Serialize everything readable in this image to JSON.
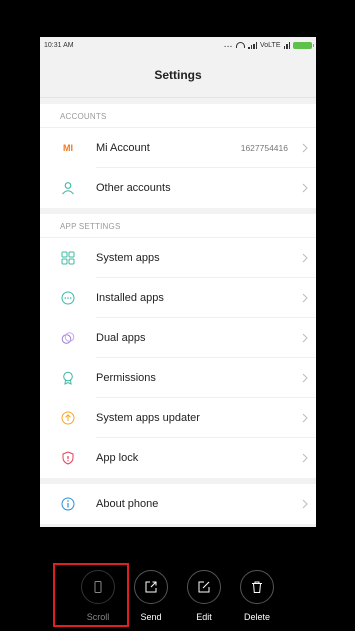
{
  "status": {
    "time": "10:31 AM",
    "dots": "...",
    "network": "VoLTE"
  },
  "header": {
    "title": "Settings"
  },
  "sections": [
    {
      "title": "ACCOUNTS",
      "items": [
        {
          "label": "Mi Account",
          "value": "1627754416",
          "icon": "mi-logo-icon"
        },
        {
          "label": "Other accounts",
          "icon": "person-icon"
        }
      ]
    },
    {
      "title": "APP SETTINGS",
      "items": [
        {
          "label": "System apps",
          "icon": "grid-icon"
        },
        {
          "label": "Installed apps",
          "icon": "more-circle-icon"
        },
        {
          "label": "Dual apps",
          "icon": "dual-circles-icon"
        },
        {
          "label": "Permissions",
          "icon": "badge-icon"
        },
        {
          "label": "System apps updater",
          "icon": "upload-icon"
        },
        {
          "label": "App lock",
          "icon": "shield-icon"
        }
      ]
    },
    {
      "items": [
        {
          "label": "About phone",
          "icon": "info-icon"
        }
      ]
    }
  ],
  "mi_logo_text": "MI",
  "toolbar": {
    "scroll": "Scroll",
    "send": "Send",
    "edit": "Edit",
    "delete": "Delete"
  },
  "colors": {
    "accent_orange": "#f5791f",
    "teal": "#3bb9a3",
    "red_highlight": "#e02020",
    "battery_green": "#5fc04b"
  }
}
